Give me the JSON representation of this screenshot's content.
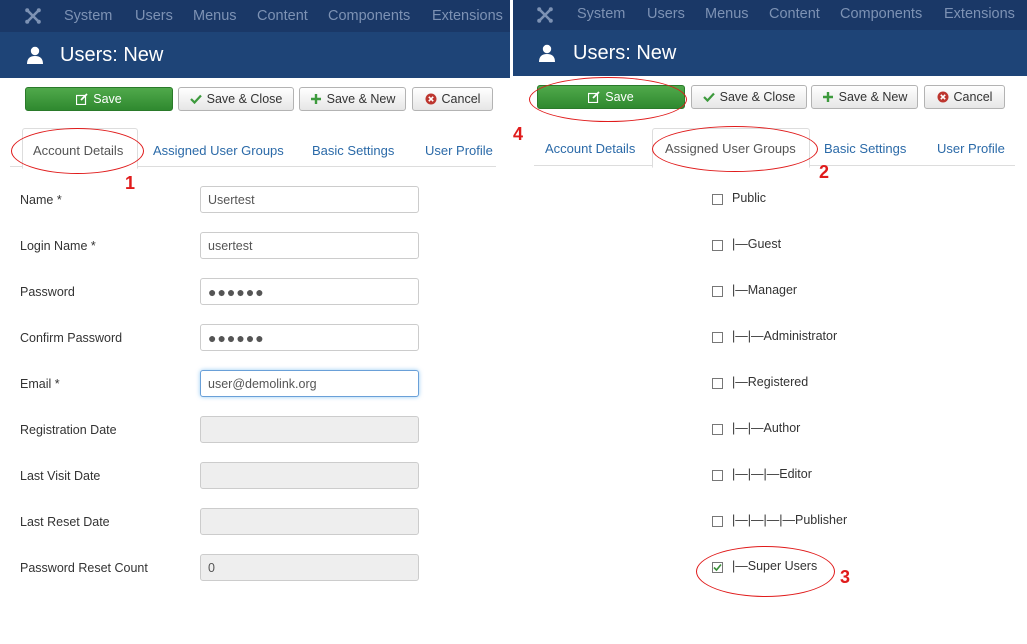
{
  "nav": {
    "items": [
      "System",
      "Users",
      "Menus",
      "Content",
      "Components",
      "Extensions"
    ]
  },
  "page": {
    "title": "Users: New"
  },
  "toolbar": {
    "save": "Save",
    "save_close": "Save & Close",
    "save_new": "Save & New",
    "cancel": "Cancel"
  },
  "tabs": [
    "Account Details",
    "Assigned User Groups",
    "Basic Settings",
    "User Profile"
  ],
  "form": {
    "fields": [
      {
        "label": "Name *",
        "value": "Usertest"
      },
      {
        "label": "Login Name *",
        "value": "usertest"
      },
      {
        "label": "Password",
        "value": "●●●●●●"
      },
      {
        "label": "Confirm Password",
        "value": "●●●●●●"
      },
      {
        "label": "Email *",
        "value": "user@demolink.org"
      },
      {
        "label": "Registration Date",
        "value": ""
      },
      {
        "label": "Last Visit Date",
        "value": ""
      },
      {
        "label": "Last Reset Date",
        "value": ""
      },
      {
        "label": "Password Reset Count",
        "value": "0"
      }
    ]
  },
  "groups": [
    {
      "label": "Public",
      "checked": false
    },
    {
      "label": "|—Guest",
      "checked": false
    },
    {
      "label": "|—Manager",
      "checked": false
    },
    {
      "label": "|—|—Administrator",
      "checked": false
    },
    {
      "label": "|—Registered",
      "checked": false
    },
    {
      "label": "|—|—Author",
      "checked": false
    },
    {
      "label": "|—|—|—Editor",
      "checked": false
    },
    {
      "label": "|—|—|—|—Publisher",
      "checked": false
    },
    {
      "label": "|—Super Users",
      "checked": true
    }
  ],
  "annotations": {
    "step1": "1",
    "step2": "2",
    "step3": "3",
    "step4": "4"
  },
  "colors": {
    "nav_bg": "#1a3867",
    "title_bg": "#1e4477",
    "save_green": "#3d9a3d",
    "annotation_red": "#e01b1b",
    "link_blue": "#2b6aa8"
  }
}
